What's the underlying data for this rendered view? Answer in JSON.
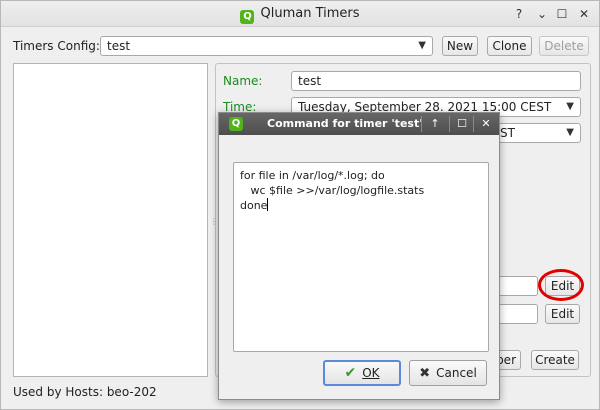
{
  "window": {
    "title": "Qluman Timers",
    "logo_letter": "Q",
    "controls": {
      "help": "?",
      "minimize": "⌄",
      "maximize": "☐",
      "close": "✕"
    }
  },
  "config": {
    "label": "Timers Config:",
    "selected": "test",
    "new_label": "New",
    "clone_label": "Clone",
    "delete_label": "Delete"
  },
  "form": {
    "name_label": "Name:",
    "name_value": "test",
    "time_label": "Time:",
    "time_value": "Tuesday, September 28. 2021 15:00 CEST",
    "second_combo_value": "ST",
    "edit_label_1": "Edit",
    "edit_label_2": "Edit",
    "partial_button_label": "ber",
    "create_label": "Create"
  },
  "status": {
    "used_by_hosts": "Used by Hosts: beo-202"
  },
  "dialog": {
    "title": "Command for timer 'test'",
    "logo_letter": "Q",
    "controls": {
      "up": "↑",
      "maximize": "☐",
      "close": "✕"
    },
    "command_lines": [
      "for file in /var/log/*.log; do",
      "   wc $file >>/var/log/logfile.stats",
      "done"
    ],
    "ok_label": "OK",
    "cancel_label": "Cancel",
    "ok_icon": "check-icon",
    "cancel_icon": "x-icon"
  },
  "colors": {
    "label_green": "#1c8a1c",
    "highlight_red": "#e00000",
    "dialog_title_bg": "#555555",
    "logo_green": "#53b31b"
  }
}
